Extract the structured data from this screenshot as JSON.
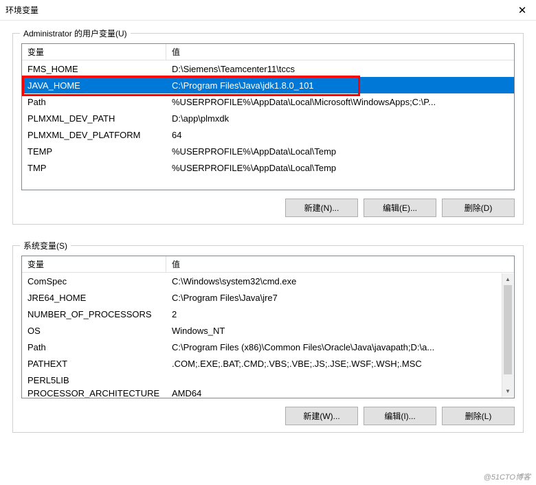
{
  "title": "环境变量",
  "user_vars": {
    "group_label": "Administrator 的用户变量(U)",
    "header_var": "变量",
    "header_val": "值",
    "rows": [
      {
        "var": "FMS_HOME",
        "val": "D:\\Siemens\\Teamcenter11\\tccs",
        "selected": false
      },
      {
        "var": "JAVA_HOME",
        "val": "C:\\Program Files\\Java\\jdk1.8.0_101",
        "selected": true
      },
      {
        "var": "Path",
        "val": "%USERPROFILE%\\AppData\\Local\\Microsoft\\WindowsApps;C:\\P...",
        "selected": false
      },
      {
        "var": "PLMXML_DEV_PATH",
        "val": "D:\\app\\plmxdk",
        "selected": false
      },
      {
        "var": "PLMXML_DEV_PLATFORM",
        "val": "64",
        "selected": false
      },
      {
        "var": "TEMP",
        "val": "%USERPROFILE%\\AppData\\Local\\Temp",
        "selected": false
      },
      {
        "var": "TMP",
        "val": "%USERPROFILE%\\AppData\\Local\\Temp",
        "selected": false
      }
    ],
    "buttons": {
      "new": "新建(N)...",
      "edit": "编辑(E)...",
      "delete": "删除(D)"
    }
  },
  "sys_vars": {
    "group_label": "系统变量(S)",
    "header_var": "变量",
    "header_val": "值",
    "rows": [
      {
        "var": "ComSpec",
        "val": "C:\\Windows\\system32\\cmd.exe"
      },
      {
        "var": "JRE64_HOME",
        "val": "C:\\Program Files\\Java\\jre7"
      },
      {
        "var": "NUMBER_OF_PROCESSORS",
        "val": "2"
      },
      {
        "var": "OS",
        "val": "Windows_NT"
      },
      {
        "var": "Path",
        "val": "C:\\Program Files (x86)\\Common Files\\Oracle\\Java\\javapath;D:\\a..."
      },
      {
        "var": "PATHEXT",
        "val": ".COM;.EXE;.BAT;.CMD;.VBS;.VBE;.JS;.JSE;.WSF;.WSH;.MSC"
      },
      {
        "var": "PERL5LIB",
        "val": ""
      }
    ],
    "partial_row": {
      "var": "PROCESSOR_ARCHITECTURE",
      "val": "AMD64"
    },
    "buttons": {
      "new": "新建(W)...",
      "edit": "编辑(I)...",
      "delete": "删除(L)"
    }
  },
  "watermark": "@51CTO博客"
}
